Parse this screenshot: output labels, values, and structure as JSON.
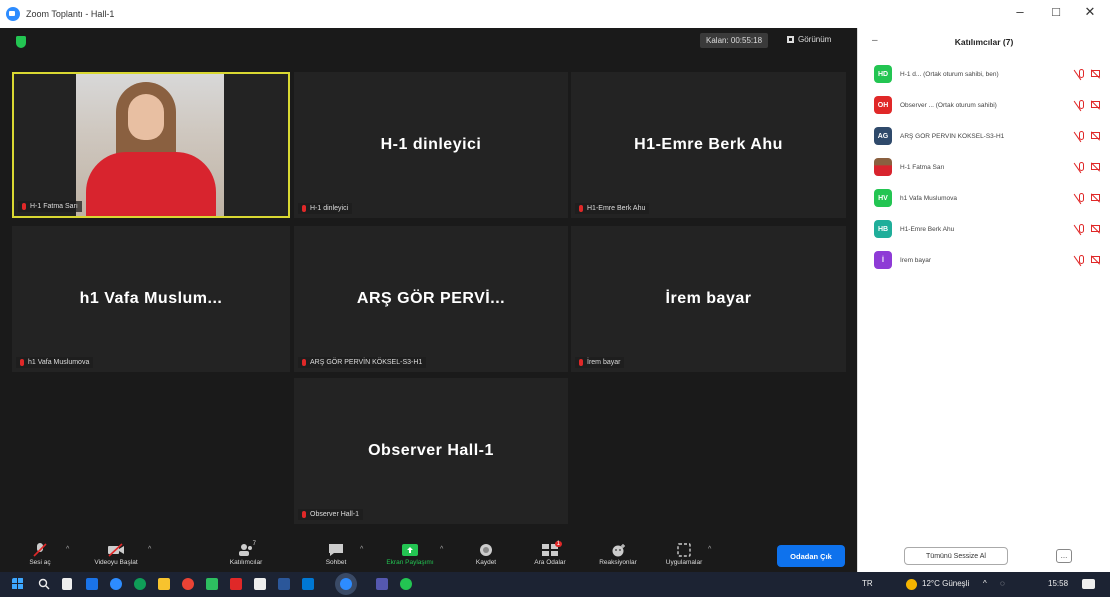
{
  "window": {
    "title": "Zoom Toplantı - Hall-1",
    "controls": [
      "–",
      "□",
      "✕"
    ]
  },
  "meeting": {
    "timer": "Kalan: 00:55:18",
    "view_label": "Görünüm",
    "tiles": [
      {
        "id": "fatma",
        "caption": "H-1 Fatma Sarı",
        "display_name": "",
        "has_video": true
      },
      {
        "id": "dinleyici",
        "caption": "H-1 dinleyici",
        "display_name": "H-1 dinleyici",
        "has_video": false
      },
      {
        "id": "emre",
        "caption": "H1-Emre Berk Ahu",
        "display_name": "H1-Emre Berk Ahu",
        "has_video": false
      },
      {
        "id": "vafa",
        "caption": "h1 Vafa Muslumova",
        "display_name": "h1 Vafa Muslum...",
        "has_video": false
      },
      {
        "id": "pervin",
        "caption": "ARŞ GÖR PERVİN KÖKSEL-S3-H1",
        "display_name": "ARŞ GÖR PERVİ...",
        "has_video": false
      },
      {
        "id": "irem",
        "caption": "İrem bayar",
        "display_name": "İrem bayar",
        "has_video": false
      },
      {
        "id": "observer",
        "caption": "Observer Hall-1",
        "display_name": "Observer Hall-1",
        "has_video": false
      }
    ]
  },
  "toolbar": {
    "audio": "Sesi aç",
    "video": "Videoyu Başlat",
    "participants": "Katılımcılar",
    "participants_count": "7",
    "chat": "Sohbet",
    "share": "Ekran Paylaşımı",
    "record": "Kaydet",
    "breakout": "Ara Odalar",
    "breakout_badge": "1",
    "reactions": "Reaksiyonlar",
    "apps": "Uygulamalar",
    "leave": "Odadan Çık"
  },
  "panel": {
    "title": "Katılımcılar (7)",
    "participants": [
      {
        "initials": "HD",
        "color": "#23c552",
        "name": "H-1 d... (Ortak oturum sahibi, ben)"
      },
      {
        "initials": "OH",
        "color": "#e02828",
        "name": "Observer ... (Ortak oturum sahibi)"
      },
      {
        "initials": "AG",
        "color": "#2f4a6b",
        "name": "ARŞ GÖR PERVİN KÖKSEL-S3-H1"
      },
      {
        "initials": "",
        "color": "#b03030",
        "name": "H-1 Fatma Sarı"
      },
      {
        "initials": "HV",
        "color": "#23c552",
        "name": "h1 Vafa Muslumova"
      },
      {
        "initials": "HB",
        "color": "#1fae9a",
        "name": "H1-Emre Berk Ahu"
      },
      {
        "initials": "İ",
        "color": "#8e3bd6",
        "name": "İrem bayar"
      }
    ],
    "mute_all": "Tümünü Sessize Al",
    "more": "..."
  },
  "taskbar": {
    "weather": "12°C Güneşli",
    "time": "15:58",
    "icons": [
      "windows-start-icon",
      "search-icon",
      "task-view-icon",
      "widgets-icon",
      "edge-icon",
      "chrome-icon",
      "file-explorer-icon",
      "store-icon",
      "zoom-icon",
      "word-icon",
      "teams-icon"
    ]
  }
}
